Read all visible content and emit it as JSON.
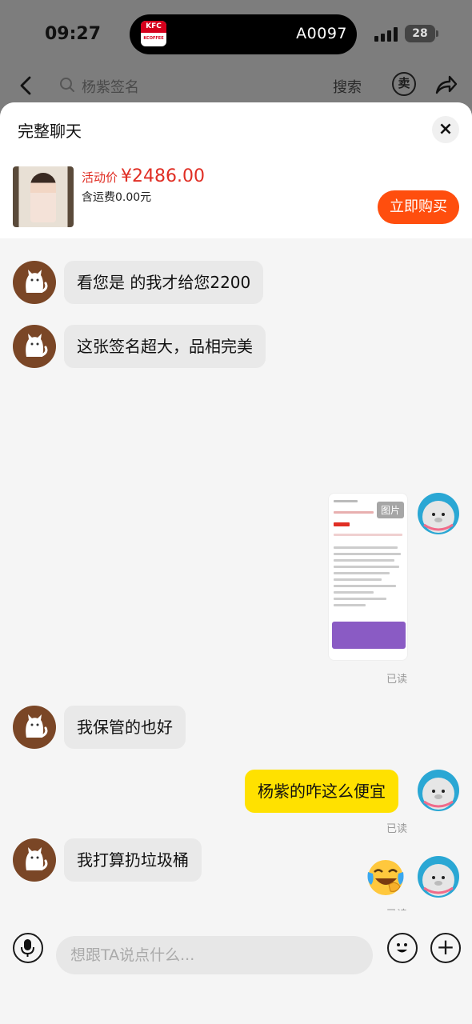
{
  "status_bar": {
    "time": "09:27",
    "island_logo_top": "KFC",
    "island_logo_bottom": "KCOFFEE",
    "island_text": "A0097",
    "battery": "28"
  },
  "nav": {
    "search_placeholder": "杨紫签名",
    "search_button": "搜索",
    "sell_icon_text": "卖"
  },
  "sheet": {
    "title": "完整聊天",
    "close_glyph": "×",
    "product": {
      "price_label": "活动价",
      "price": "¥2486.00",
      "shipping": "含运费0.00元",
      "buy_button": "立即购买"
    }
  },
  "messages": [
    {
      "side": "left",
      "text": "看您是    的我才给您2200"
    },
    {
      "side": "left",
      "text": "这张签名超大，品相完美"
    },
    {
      "side": "right",
      "type": "image",
      "tag": "图片",
      "read": "已读"
    },
    {
      "side": "left",
      "text": "我保管的也好"
    },
    {
      "side": "right",
      "text": "杨紫的咋这么便宜",
      "read": "已读"
    },
    {
      "side": "right",
      "type": "emoji",
      "emoji": "laugh-cry",
      "read": "已读"
    },
    {
      "side": "left",
      "text": "我打算扔垃圾桶"
    }
  ],
  "input": {
    "placeholder": "想跟TA说点什么..."
  },
  "colors": {
    "accent_yellow": "#ffe100",
    "price_red": "#e02e24",
    "buy_orange": "#ff4e0e"
  }
}
